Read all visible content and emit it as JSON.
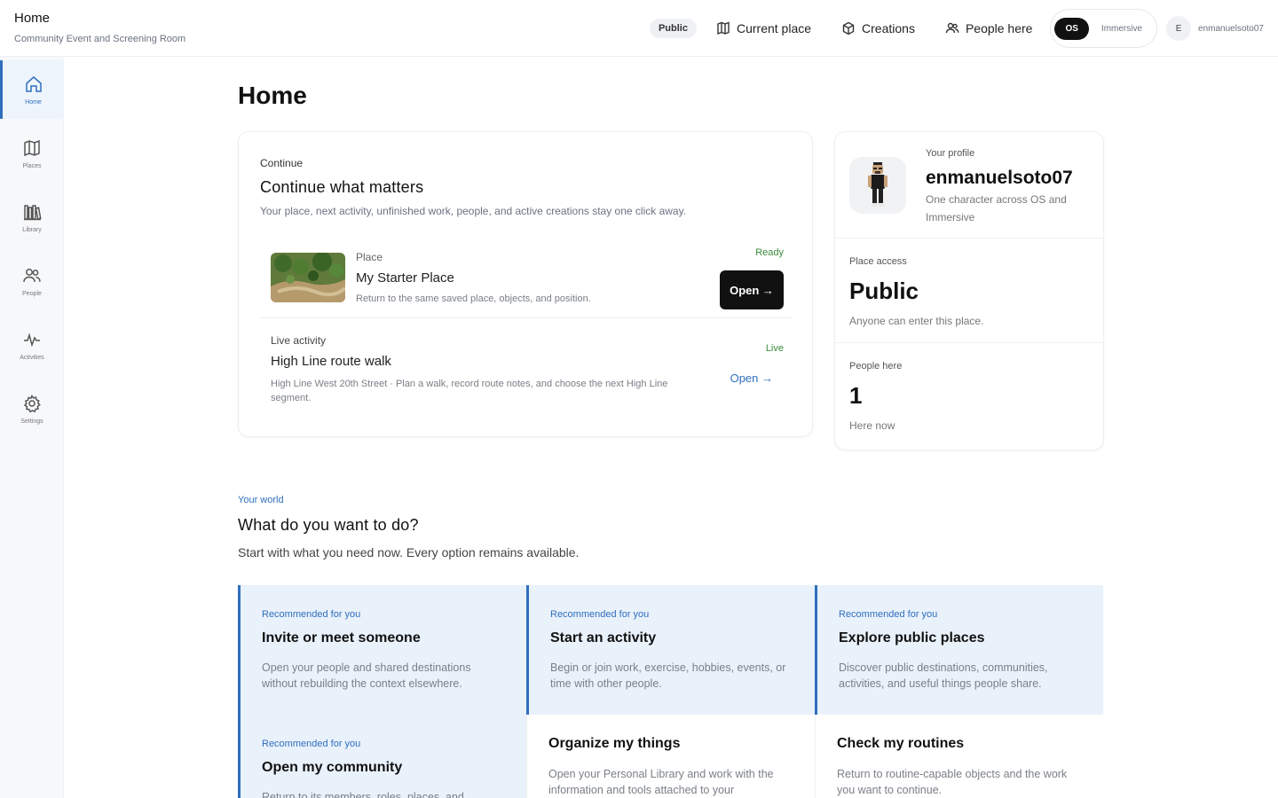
{
  "topbar": {
    "title": "Home",
    "subtitle": "Community Event and Screening Room",
    "access_pill": "Public",
    "nav": [
      {
        "label": "Current place",
        "icon": "map-icon"
      },
      {
        "label": "Creations",
        "icon": "cube-icon"
      },
      {
        "label": "People here",
        "icon": "people-icon"
      }
    ],
    "mode_os": "OS",
    "mode_immersive": "Immersive",
    "account_initial": "E",
    "account_name": "enmanuelsoto07"
  },
  "sidebar": {
    "items": [
      {
        "label": "Home",
        "icon": "home-icon",
        "active": true
      },
      {
        "label": "Places",
        "icon": "map-icon"
      },
      {
        "label": "Library",
        "icon": "library-icon"
      },
      {
        "label": "People",
        "icon": "people-icon"
      },
      {
        "label": "Activities",
        "icon": "pulse-icon"
      },
      {
        "label": "Settings",
        "icon": "gear-icon"
      }
    ]
  },
  "main": {
    "title": "Home",
    "continue": {
      "eyebrow": "Continue",
      "title": "Continue what matters",
      "description": "Your place, next activity, unfinished work, people, and active creations stay one click away.",
      "place": {
        "type": "Place",
        "name": "My Starter Place",
        "description": "Return to the same saved place, objects, and position.",
        "status": "Ready",
        "button": "Open →"
      },
      "activity": {
        "type": "Live activity",
        "name": "High Line route walk",
        "description": "High Line West 20th Street · Plan a walk, record route notes, and choose the next High Line segment.",
        "status": "Live",
        "link": "Open →"
      }
    },
    "profile": {
      "eyebrow": "Your profile",
      "name": "enmanuelsoto07",
      "description": "One character across OS and Immersive",
      "access_eyebrow": "Place access",
      "access_value": "Public",
      "access_desc": "Anyone can enter this place.",
      "people_eyebrow": "People here",
      "people_value": "1",
      "people_desc": "Here now"
    },
    "world": {
      "eyebrow": "Your world",
      "title": "What do you want to do?",
      "description": "Start with what you need now. Every option remains available."
    },
    "tiles": [
      {
        "eyebrow": "Recommended for you",
        "title": "Invite or meet someone",
        "description": "Open your people and shared destinations without rebuilding the context elsewhere."
      },
      {
        "eyebrow": "Recommended for you",
        "title": "Start an activity",
        "description": "Begin or join work, exercise, hobbies, events, or time with other people."
      },
      {
        "eyebrow": "Recommended for you",
        "title": "Explore public places",
        "description": "Discover public destinations, communities, activities, and useful things people share."
      },
      {
        "eyebrow": "Recommended for you",
        "title": "Open my community",
        "description": "Return to its members, roles, places, and"
      },
      {
        "eyebrow": "",
        "title": "Organize my things",
        "description": "Open your Personal Library and work with the information and tools attached to your"
      },
      {
        "eyebrow": "",
        "title": "Check my routines",
        "description": "Return to routine-capable objects and the work you want to continue."
      }
    ]
  },
  "colors": {
    "accent": "#2f6fbd",
    "recommended_bg": "#e9f1fb",
    "live_green": "#3a8a3a"
  }
}
